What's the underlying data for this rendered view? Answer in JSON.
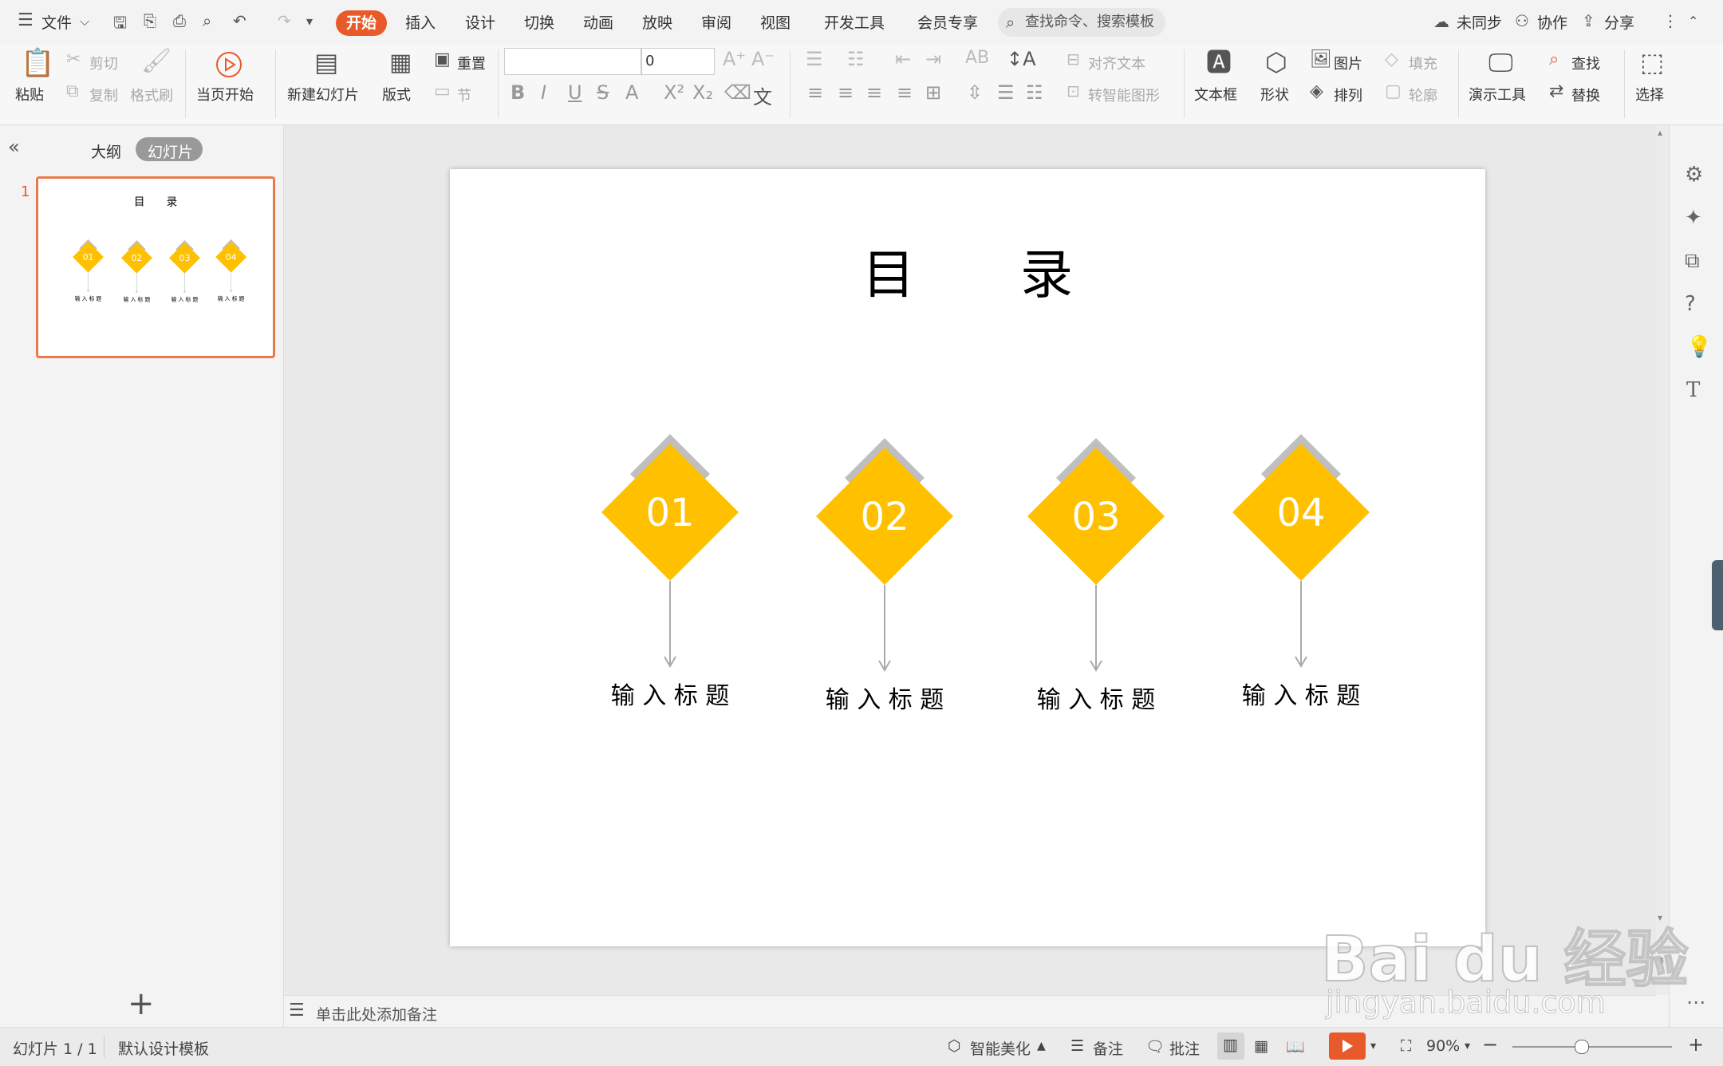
{
  "menubar": {
    "file": "文件",
    "tabs": [
      "开始",
      "插入",
      "设计",
      "切换",
      "动画",
      "放映",
      "审阅",
      "视图",
      "开发工具",
      "会员专享"
    ],
    "search": "查找命令、搜索模板",
    "unsynced": "未同步",
    "collab": "协作",
    "share": "分享"
  },
  "ribbon": {
    "paste": "粘贴",
    "cut": "剪切",
    "copy": "复制",
    "format_painter": "格式刷",
    "play_from_current": "当页开始",
    "new_slide": "新建幻灯片",
    "layout": "版式",
    "reset": "重置",
    "section": "节",
    "font_size": "0",
    "align_text": "对齐文本",
    "smartart": "转智能图形",
    "textbox": "文本框",
    "shape": "形状",
    "picture": "图片",
    "arrange": "排列",
    "fill": "填充",
    "outline": "轮廓",
    "presenter_tools": "演示工具",
    "find": "查找",
    "replace": "替换",
    "select": "选择"
  },
  "leftpanel": {
    "outline_tab": "大纲",
    "slides_tab": "幻灯片",
    "slide_number": "1",
    "add": "+"
  },
  "slide": {
    "title": "目　　录",
    "items": [
      {
        "number": "01",
        "label": "输 入 标 题"
      },
      {
        "number": "02",
        "label": "输 入 标 题"
      },
      {
        "number": "03",
        "label": "输 入 标 题"
      },
      {
        "number": "04",
        "label": "输 入 标 题"
      }
    ],
    "accent": "#ffc000",
    "shadow": "#bfbfbf"
  },
  "notes": {
    "placeholder": "单击此处添加备注"
  },
  "statusbar": {
    "slide_count": "幻灯片 1 / 1",
    "template": "默认设计模板",
    "beautify": "智能美化",
    "notes": "备注",
    "comments": "批注",
    "zoom": "90%"
  },
  "watermark": {
    "brand": "Bai du 经验",
    "url": "jingyan.baidu.com"
  }
}
